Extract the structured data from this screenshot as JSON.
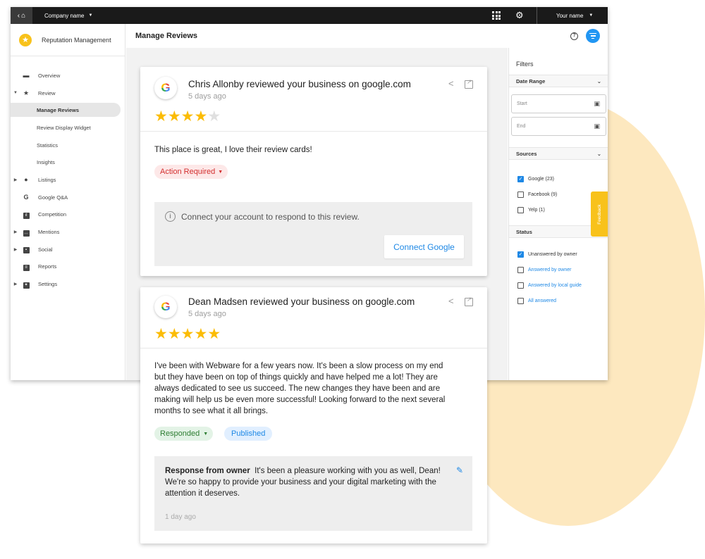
{
  "colors": {
    "accent": "#2196f3",
    "star": "#fbbc05",
    "feedback": "#f8c21b",
    "blob": "#fde4b4"
  },
  "topbar": {
    "company": "Company name",
    "user": "Your name",
    "apps_icon": "apps-grid-icon",
    "settings_icon": "gear-icon"
  },
  "sidebar": {
    "brand": "Reputation Management",
    "items": [
      {
        "label": "Overview",
        "icon": "overview-icon"
      },
      {
        "label": "Review",
        "icon": "star-icon",
        "expanded": true
      },
      {
        "label": "Manage Reviews",
        "active": true
      },
      {
        "label": "Review Display Widget"
      },
      {
        "label": "Statistics"
      },
      {
        "label": "Insights"
      },
      {
        "label": "Listings",
        "icon": "location-pin-icon"
      },
      {
        "label": "Google Q&A",
        "icon": "google-icon"
      },
      {
        "label": "Competition",
        "icon": "bar-chart-icon"
      },
      {
        "label": "Mentions",
        "icon": "comment-icon"
      },
      {
        "label": "Social",
        "icon": "chat-icon"
      },
      {
        "label": "Reports",
        "icon": "document-icon"
      },
      {
        "label": "Settings",
        "icon": "settings-icon"
      }
    ]
  },
  "main": {
    "title": "Manage Reviews"
  },
  "filters": {
    "title": "Filters",
    "date_range": {
      "label": "Date Range",
      "start_placeholder": "Start",
      "end_placeholder": "End"
    },
    "sources": {
      "label": "Sources",
      "options": [
        {
          "label": "Google (23)",
          "checked": true
        },
        {
          "label": "Facebook (9)",
          "checked": false
        },
        {
          "label": "Yelp (1)",
          "checked": false
        }
      ]
    },
    "status": {
      "label": "Status",
      "options": [
        {
          "label": "Unanswered by owner",
          "checked": true
        },
        {
          "label": "Answered by owner",
          "checked": false
        },
        {
          "label": "Answered by local guide",
          "checked": false
        },
        {
          "label": "All answered",
          "checked": false
        }
      ]
    }
  },
  "feedback_tab": "Feedback",
  "reviews": [
    {
      "title": "Chris Allonby reviewed your business on google.com",
      "time": "5 days ago",
      "rating": 4,
      "max_rating": 5,
      "body": "This place is great, I love their review cards!",
      "status_chip": "Action Required",
      "connect_text": "Connect your account to respond to this review.",
      "connect_button": "Connect Google"
    },
    {
      "title": "Dean Madsen reviewed your business on google.com",
      "time": "5 days ago",
      "rating": 5,
      "max_rating": 5,
      "body": "I've been with Webware for a few years now. It's been a slow process on my end but they have been on top of things quickly and have helped me a lot! They are always dedicated to see us succeed. The new changes they have been and are making will help us be even more successful! Looking forward to the next several months to see what it all brings.",
      "status_chip": "Responded",
      "published_chip": "Published",
      "response_label": "Response from owner",
      "response_text": "It's been a pleasure working with you as well, Dean! We're so happy to provide your business and your digital marketing with the attention it deserves.",
      "response_time": "1 day ago"
    }
  ]
}
